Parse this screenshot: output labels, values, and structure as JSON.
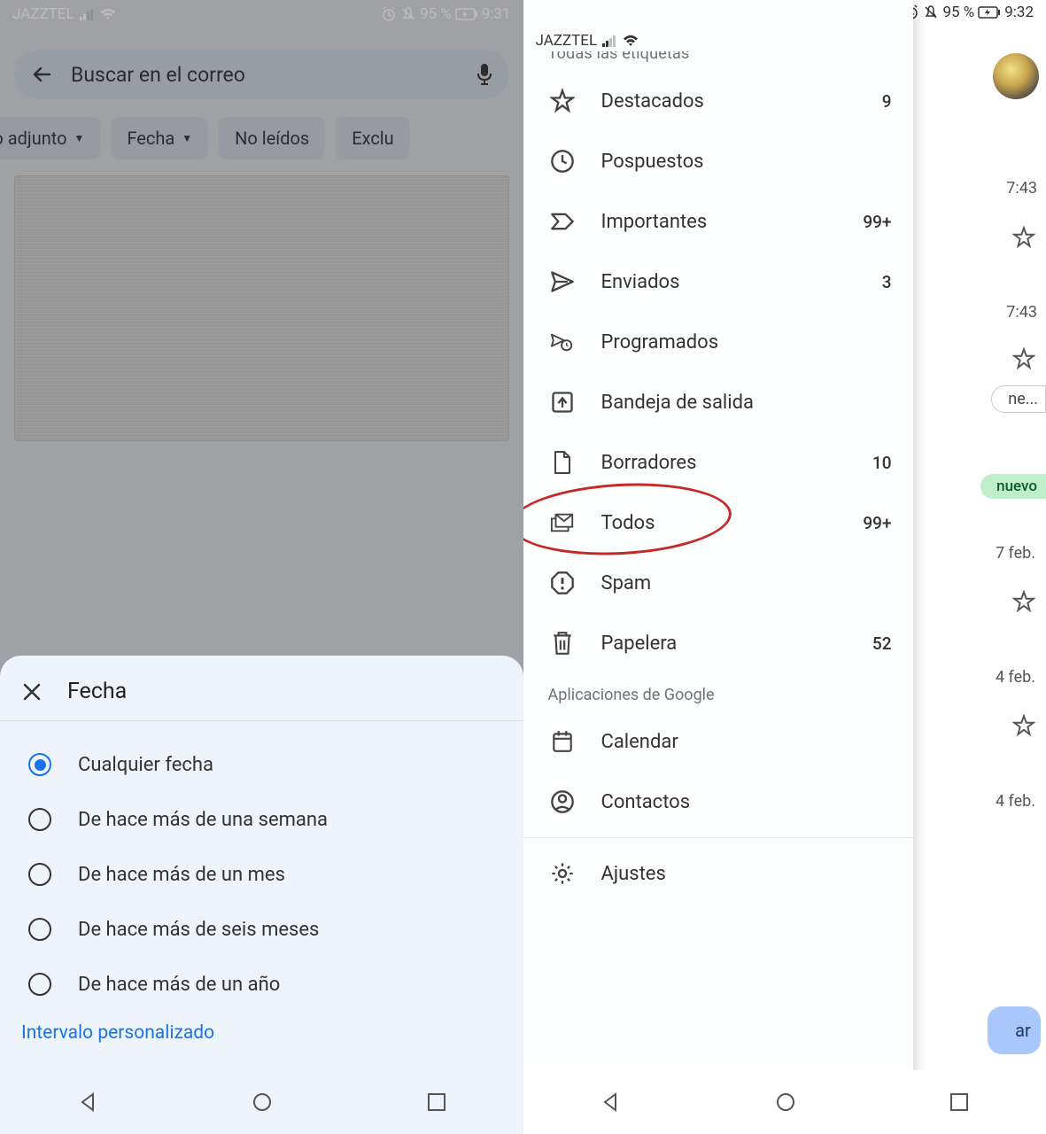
{
  "left": {
    "status": {
      "carrier": "JAZZTEL",
      "battery": "95 %",
      "time": "9:31"
    },
    "search_placeholder": "Buscar en el correo",
    "chips": {
      "attachment": "ivo adjunto",
      "date": "Fecha",
      "unread": "No leídos",
      "exclude": "Exclu"
    },
    "sheet": {
      "title": "Fecha",
      "options": [
        "Cualquier fecha",
        "De hace más de una semana",
        "De hace más de un mes",
        "De hace más de seis meses",
        "De hace más de un año"
      ],
      "custom": "Intervalo personalizado"
    }
  },
  "right": {
    "status": {
      "carrier": "JAZZTEL",
      "battery": "95 %",
      "time": "9:32"
    },
    "drawer_header": "Todas las etiquetas",
    "items": [
      {
        "label": "Destacados",
        "count": "9"
      },
      {
        "label": "Pospuestos",
        "count": ""
      },
      {
        "label": "Importantes",
        "count": "99+"
      },
      {
        "label": "Enviados",
        "count": "3"
      },
      {
        "label": "Programados",
        "count": ""
      },
      {
        "label": "Bandeja de salida",
        "count": ""
      },
      {
        "label": "Borradores",
        "count": "10"
      },
      {
        "label": "Todos",
        "count": "99+"
      },
      {
        "label": "Spam",
        "count": ""
      },
      {
        "label": "Papelera",
        "count": "52"
      }
    ],
    "apps_header": "Aplicaciones de Google",
    "apps": [
      {
        "label": "Calendar"
      },
      {
        "label": "Contactos"
      }
    ],
    "settings": "Ajustes",
    "bg": {
      "t1": "7:43",
      "t2": "7:43",
      "d1": "7 feb.",
      "d2": "4 feb.",
      "d3": "4 feb.",
      "chip_new": "nuevo",
      "chip_ne": "ne...",
      "compose": "ar"
    }
  }
}
